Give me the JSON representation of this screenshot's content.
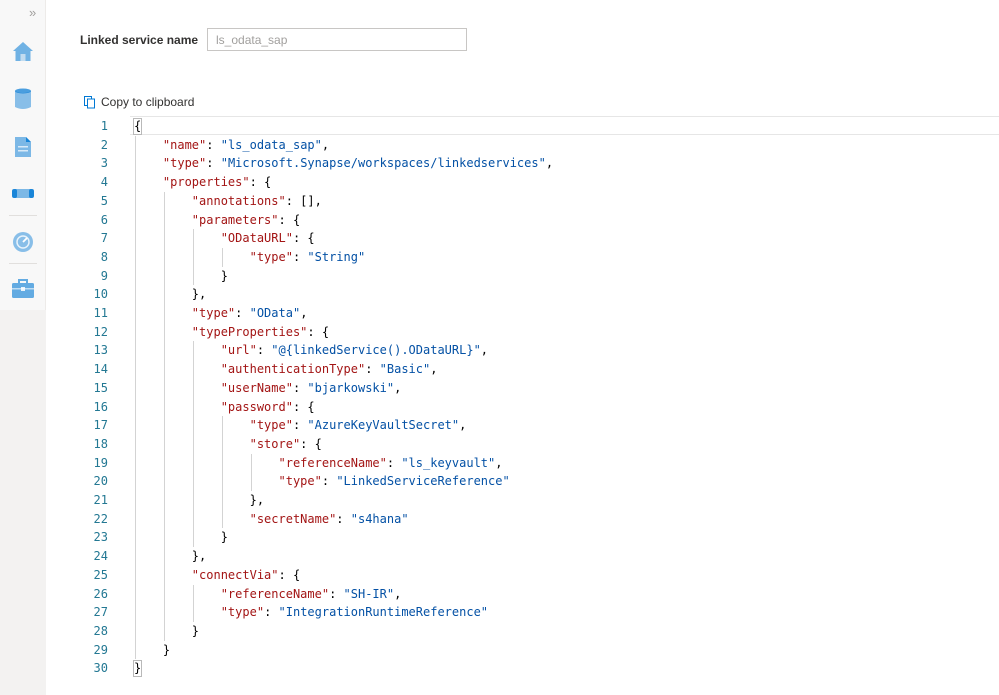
{
  "rail": {
    "expand_label": "»",
    "icons": [
      "home-icon",
      "database-icon",
      "document-icon",
      "pipeline-icon",
      "monitor-icon",
      "manage-toolbox-icon"
    ],
    "accent": "#0078d4"
  },
  "linked_service": {
    "label": "Linked service name",
    "value": "ls_odata_sap"
  },
  "copy": {
    "label": "Copy to clipboard"
  },
  "editor": {
    "lines": [
      [
        [
          "p",
          "{"
        ]
      ],
      [
        [
          "p",
          "    "
        ],
        [
          "k",
          "\"name\""
        ],
        [
          "p",
          ": "
        ],
        [
          "s",
          "\"ls_odata_sap\""
        ],
        [
          "p",
          ","
        ]
      ],
      [
        [
          "p",
          "    "
        ],
        [
          "k",
          "\"type\""
        ],
        [
          "p",
          ": "
        ],
        [
          "s",
          "\"Microsoft.Synapse/workspaces/linkedservices\""
        ],
        [
          "p",
          ","
        ]
      ],
      [
        [
          "p",
          "    "
        ],
        [
          "k",
          "\"properties\""
        ],
        [
          "p",
          ": {"
        ]
      ],
      [
        [
          "p",
          "        "
        ],
        [
          "k",
          "\"annotations\""
        ],
        [
          "p",
          ": [],"
        ]
      ],
      [
        [
          "p",
          "        "
        ],
        [
          "k",
          "\"parameters\""
        ],
        [
          "p",
          ": {"
        ]
      ],
      [
        [
          "p",
          "            "
        ],
        [
          "k",
          "\"ODataURL\""
        ],
        [
          "p",
          ": {"
        ]
      ],
      [
        [
          "p",
          "                "
        ],
        [
          "k",
          "\"type\""
        ],
        [
          "p",
          ": "
        ],
        [
          "s",
          "\"String\""
        ]
      ],
      [
        [
          "p",
          "            }"
        ]
      ],
      [
        [
          "p",
          "        },"
        ]
      ],
      [
        [
          "p",
          "        "
        ],
        [
          "k",
          "\"type\""
        ],
        [
          "p",
          ": "
        ],
        [
          "s",
          "\"OData\""
        ],
        [
          "p",
          ","
        ]
      ],
      [
        [
          "p",
          "        "
        ],
        [
          "k",
          "\"typeProperties\""
        ],
        [
          "p",
          ": {"
        ]
      ],
      [
        [
          "p",
          "            "
        ],
        [
          "k",
          "\"url\""
        ],
        [
          "p",
          ": "
        ],
        [
          "s",
          "\"@{linkedService().ODataURL}\""
        ],
        [
          "p",
          ","
        ]
      ],
      [
        [
          "p",
          "            "
        ],
        [
          "k",
          "\"authenticationType\""
        ],
        [
          "p",
          ": "
        ],
        [
          "s",
          "\"Basic\""
        ],
        [
          "p",
          ","
        ]
      ],
      [
        [
          "p",
          "            "
        ],
        [
          "k",
          "\"userName\""
        ],
        [
          "p",
          ": "
        ],
        [
          "s",
          "\"bjarkowski\""
        ],
        [
          "p",
          ","
        ]
      ],
      [
        [
          "p",
          "            "
        ],
        [
          "k",
          "\"password\""
        ],
        [
          "p",
          ": {"
        ]
      ],
      [
        [
          "p",
          "                "
        ],
        [
          "k",
          "\"type\""
        ],
        [
          "p",
          ": "
        ],
        [
          "s",
          "\"AzureKeyVaultSecret\""
        ],
        [
          "p",
          ","
        ]
      ],
      [
        [
          "p",
          "                "
        ],
        [
          "k",
          "\"store\""
        ],
        [
          "p",
          ": {"
        ]
      ],
      [
        [
          "p",
          "                    "
        ],
        [
          "k",
          "\"referenceName\""
        ],
        [
          "p",
          ": "
        ],
        [
          "s",
          "\"ls_keyvault\""
        ],
        [
          "p",
          ","
        ]
      ],
      [
        [
          "p",
          "                    "
        ],
        [
          "k",
          "\"type\""
        ],
        [
          "p",
          ": "
        ],
        [
          "s",
          "\"LinkedServiceReference\""
        ]
      ],
      [
        [
          "p",
          "                },"
        ]
      ],
      [
        [
          "p",
          "                "
        ],
        [
          "k",
          "\"secretName\""
        ],
        [
          "p",
          ": "
        ],
        [
          "s",
          "\"s4hana\""
        ]
      ],
      [
        [
          "p",
          "            }"
        ]
      ],
      [
        [
          "p",
          "        },"
        ]
      ],
      [
        [
          "p",
          "        "
        ],
        [
          "k",
          "\"connectVia\""
        ],
        [
          "p",
          ": {"
        ]
      ],
      [
        [
          "p",
          "            "
        ],
        [
          "k",
          "\"referenceName\""
        ],
        [
          "p",
          ": "
        ],
        [
          "s",
          "\"SH-IR\""
        ],
        [
          "p",
          ","
        ]
      ],
      [
        [
          "p",
          "            "
        ],
        [
          "k",
          "\"type\""
        ],
        [
          "p",
          ": "
        ],
        [
          "s",
          "\"IntegrationRuntimeReference\""
        ]
      ],
      [
        [
          "p",
          "        }"
        ]
      ],
      [
        [
          "p",
          "    }"
        ]
      ],
      [
        [
          "p",
          "}"
        ]
      ]
    ],
    "colors": {
      "key": "#a31515",
      "string": "#0451a5",
      "line_number": "#237893"
    }
  }
}
